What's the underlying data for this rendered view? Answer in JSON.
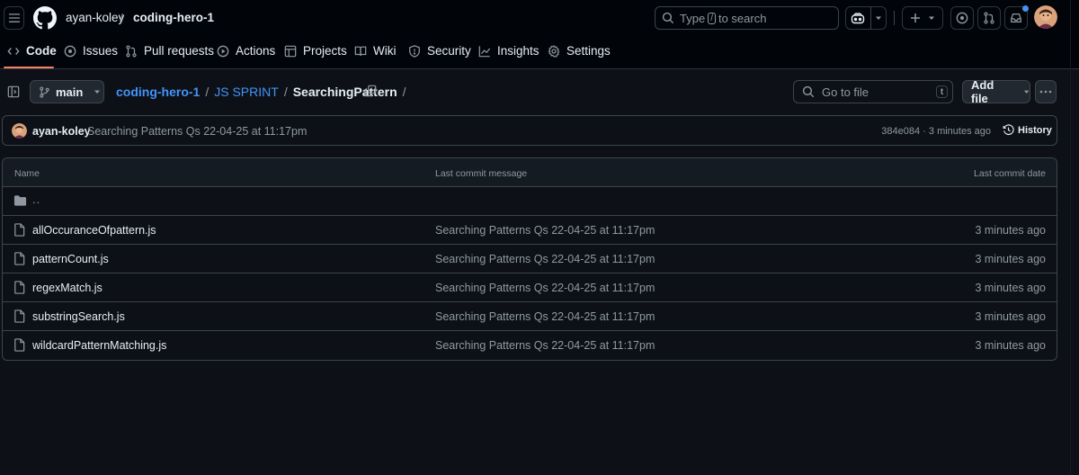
{
  "header": {
    "owner": "ayan-koley",
    "separator": "/",
    "repo": "coding-hero-1",
    "search": {
      "prefix": "Type",
      "key": "/",
      "suffix": "to search"
    }
  },
  "repo_nav": {
    "items": [
      {
        "label": "Code",
        "icon": "code-icon",
        "active": true
      },
      {
        "label": "Issues",
        "icon": "issue-opened-icon"
      },
      {
        "label": "Pull requests",
        "icon": "git-pull-request-icon"
      },
      {
        "label": "Actions",
        "icon": "play-icon"
      },
      {
        "label": "Projects",
        "icon": "table-icon"
      },
      {
        "label": "Wiki",
        "icon": "book-icon"
      },
      {
        "label": "Security",
        "icon": "shield-icon"
      },
      {
        "label": "Insights",
        "icon": "graph-icon"
      },
      {
        "label": "Settings",
        "icon": "gear-icon"
      }
    ]
  },
  "toolbar": {
    "branch": "main",
    "path": {
      "repo": "coding-hero-1",
      "folder": "JS SPRINT",
      "current": "SearchingPattern",
      "sep": "/"
    },
    "goto_file_placeholder": "Go to file",
    "goto_file_key": "t",
    "add_file_label": "Add file"
  },
  "commit": {
    "author": "ayan-koley",
    "message": "Searching Patterns Qs 22-04-25 at 11:17pm",
    "meta": "384e084 · 3 minutes ago",
    "history_label": "History"
  },
  "table": {
    "headers": {
      "name": "Name",
      "message": "Last commit message",
      "date": "Last commit date"
    },
    "parent": "..",
    "rows": [
      {
        "name": "allOccuranceOfpattern.js",
        "message": "Searching Patterns Qs 22-04-25 at 11:17pm",
        "date": "3 minutes ago"
      },
      {
        "name": "patternCount.js",
        "message": "Searching Patterns Qs 22-04-25 at 11:17pm",
        "date": "3 minutes ago"
      },
      {
        "name": "regexMatch.js",
        "message": "Searching Patterns Qs 22-04-25 at 11:17pm",
        "date": "3 minutes ago"
      },
      {
        "name": "substringSearch.js",
        "message": "Searching Patterns Qs 22-04-25 at 11:17pm",
        "date": "3 minutes ago"
      },
      {
        "name": "wildcardPatternMatching.js",
        "message": "Searching Patterns Qs 22-04-25 at 11:17pm",
        "date": "3 minutes ago"
      }
    ]
  },
  "colors": {
    "background": "#0d1117",
    "header_bg": "#010409",
    "border": "#3d444d",
    "link": "#4493f8",
    "muted": "#9198a1",
    "active_underline": "#f78166"
  }
}
